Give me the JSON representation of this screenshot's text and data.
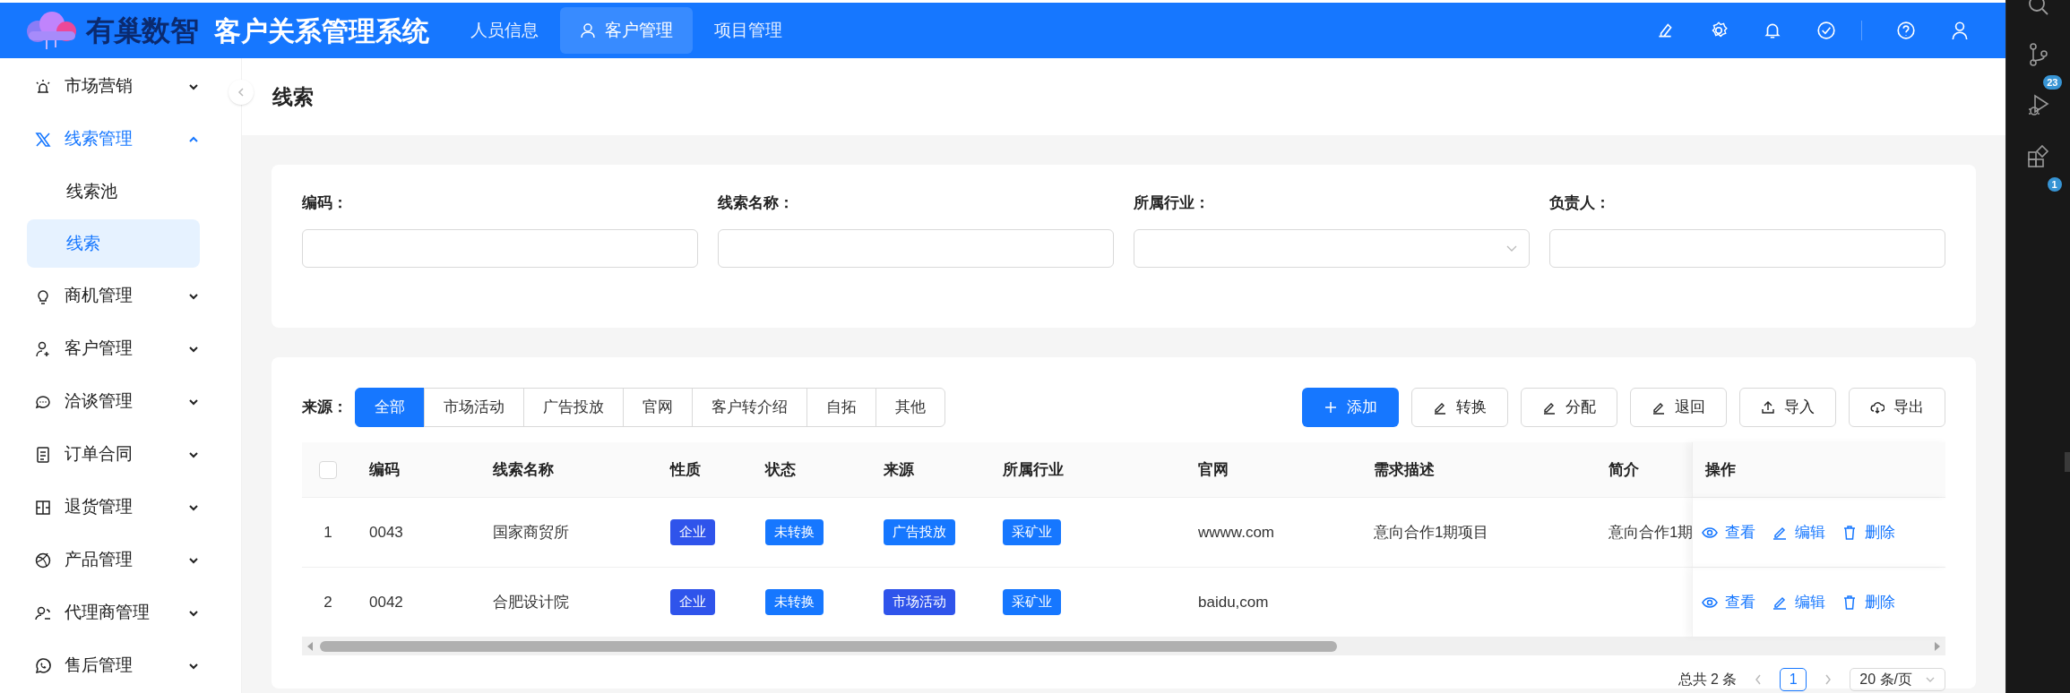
{
  "header": {
    "brand": "有巢数智",
    "title": "客户关系管理系统",
    "nav": [
      {
        "label": "人员信息",
        "selected": false
      },
      {
        "label": "客户管理",
        "selected": true
      },
      {
        "label": "项目管理",
        "selected": false
      }
    ]
  },
  "sidebar": {
    "items": [
      {
        "label": "市场营销",
        "selected": false,
        "expanded": false
      },
      {
        "label": "线索管理",
        "selected": true,
        "expanded": true,
        "children": [
          {
            "label": "线索池",
            "selected": false
          },
          {
            "label": "线索",
            "selected": true
          }
        ]
      },
      {
        "label": "商机管理",
        "selected": false,
        "expanded": false
      },
      {
        "label": "客户管理",
        "selected": false,
        "expanded": false
      },
      {
        "label": "洽谈管理",
        "selected": false,
        "expanded": false
      },
      {
        "label": "订单合同",
        "selected": false,
        "expanded": false
      },
      {
        "label": "退货管理",
        "selected": false,
        "expanded": false
      },
      {
        "label": "产品管理",
        "selected": false,
        "expanded": false
      },
      {
        "label": "代理商管理",
        "selected": false,
        "expanded": false
      },
      {
        "label": "售后管理",
        "selected": false,
        "expanded": false
      }
    ]
  },
  "page_title": "线索",
  "filters": [
    {
      "label": "编码：",
      "kind": "text"
    },
    {
      "label": "线索名称：",
      "kind": "text"
    },
    {
      "label": "所属行业：",
      "kind": "select"
    },
    {
      "label": "负责人：",
      "kind": "text"
    }
  ],
  "source_filter": {
    "label": "来源：",
    "options": [
      {
        "label": "全部",
        "selected": true
      },
      {
        "label": "市场活动",
        "selected": false
      },
      {
        "label": "广告投放",
        "selected": false
      },
      {
        "label": "官网",
        "selected": false
      },
      {
        "label": "客户转介绍",
        "selected": false
      },
      {
        "label": "自拓",
        "selected": false
      },
      {
        "label": "其他",
        "selected": false
      }
    ]
  },
  "actions": [
    {
      "label": "添加",
      "kind": "primary"
    },
    {
      "label": "转换",
      "kind": "default"
    },
    {
      "label": "分配",
      "kind": "default"
    },
    {
      "label": "退回",
      "kind": "default"
    },
    {
      "label": "导入",
      "kind": "default"
    },
    {
      "label": "导出",
      "kind": "default"
    }
  ],
  "table": {
    "select_all": {
      "checked": false
    },
    "columns": [
      {
        "title": "编码",
        "kind": "text"
      },
      {
        "title": "线索名称",
        "kind": "text"
      },
      {
        "title": "性质",
        "kind": "tag"
      },
      {
        "title": "状态",
        "kind": "tag"
      },
      {
        "title": "来源",
        "kind": "tag"
      },
      {
        "title": "所属行业",
        "kind": "tag"
      },
      {
        "title": "官网",
        "kind": "text"
      },
      {
        "title": "需求描述",
        "kind": "text"
      },
      {
        "title": "简介",
        "kind": "text"
      },
      {
        "title": "操作",
        "kind": "actions"
      }
    ],
    "rows": [
      {
        "index": "1",
        "code": "0043",
        "name": "国家商贸所",
        "nature": {
          "text": "企业",
          "color": "#2f54eb"
        },
        "status": {
          "text": "未转换",
          "color": "#1677ff"
        },
        "source": {
          "text": "广告投放",
          "color": "#1677ff"
        },
        "industry": {
          "text": "采矿业",
          "color": "#1677ff"
        },
        "website": "wwww.com",
        "demand": "意向合作1期项目",
        "intro": "意向合作1期",
        "ops": [
          "查看",
          "编辑",
          "删除"
        ]
      },
      {
        "index": "2",
        "code": "0042",
        "name": "合肥设计院",
        "nature": {
          "text": "企业",
          "color": "#2f54eb"
        },
        "status": {
          "text": "未转换",
          "color": "#1677ff"
        },
        "source": {
          "text": "市场活动",
          "color": "#2f54eb"
        },
        "industry": {
          "text": "采矿业",
          "color": "#1677ff"
        },
        "website": "baidu,com",
        "ops": [
          "查看",
          "编辑",
          "删除"
        ]
      }
    ]
  },
  "pagination": {
    "total": "总共 2 条",
    "pages": [
      {
        "label": "1",
        "selected": true
      }
    ],
    "page_size": "20 条/页"
  },
  "side_panel": {
    "source_control_badge": "23",
    "extensions_badge": "1"
  }
}
